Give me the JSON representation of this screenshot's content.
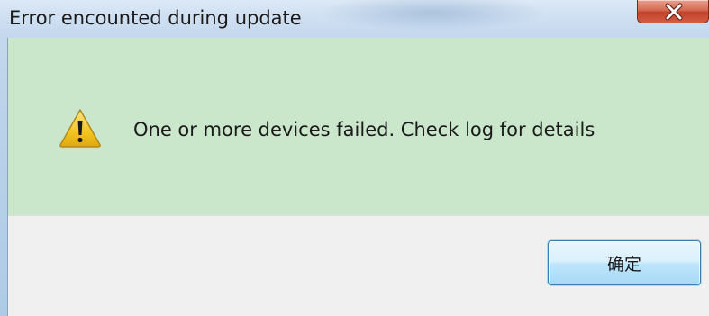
{
  "window": {
    "title": "Error encounted during update",
    "close_icon": "close-x-icon"
  },
  "dialog": {
    "icon": "warning-icon",
    "message": "One or more devices failed. Check log for details",
    "ok_label": "确定"
  },
  "colors": {
    "message_panel_bg": "#cae6cb",
    "button_area_bg": "#f0f0f0",
    "close_button": "#c2432b",
    "warning_yellow": "#f3c520"
  }
}
